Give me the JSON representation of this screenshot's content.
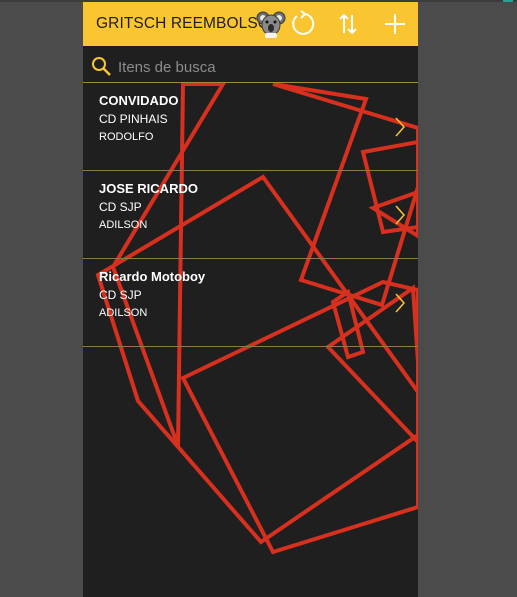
{
  "app": {
    "title": "GRITSCH REEMBOLSO"
  },
  "header": {
    "actions": [
      {
        "icon": "koala-avatar-icon",
        "label": ""
      },
      {
        "icon": "refresh-icon",
        "label": ""
      },
      {
        "icon": "sort-icon",
        "label": ""
      },
      {
        "icon": "add-icon",
        "label": ""
      }
    ]
  },
  "search": {
    "placeholder": "Itens de busca",
    "value": ""
  },
  "list": {
    "items": [
      {
        "name": "CONVIDADO",
        "location": "CD PINHAIS",
        "person": "RODOLFO"
      },
      {
        "name": "JOSE RICARDO",
        "location": "CD SJP",
        "person": "ADILSON"
      },
      {
        "name": "Ricardo Motoboy",
        "location": "CD SJP",
        "person": "ADILSON"
      }
    ]
  },
  "colors": {
    "header": "#f9c531",
    "background": "#1f1f1f",
    "accent_lines": "#d8301f",
    "divider": "#8d7a45"
  }
}
